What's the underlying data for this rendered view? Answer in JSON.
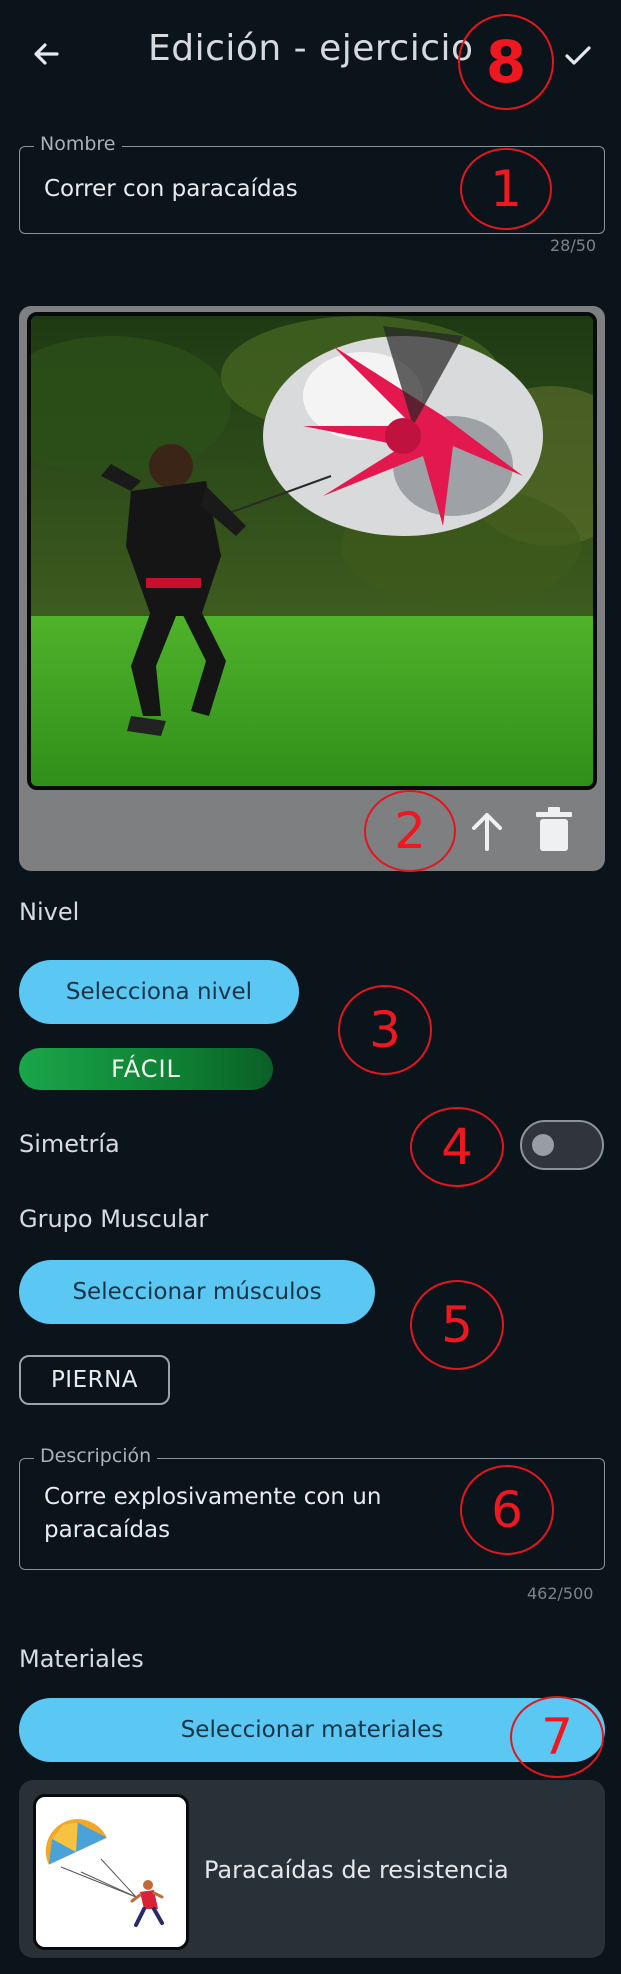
{
  "header": {
    "title": "Edición - ejercicio",
    "back_icon": "arrow-left-icon",
    "confirm_icon": "check-icon"
  },
  "name_field": {
    "legend": "Nombre",
    "value": "Correr con paracaídas",
    "counter": "28/50"
  },
  "image_section": {
    "upload_icon": "arrow-up-icon",
    "delete_icon": "trash-icon"
  },
  "level": {
    "label": "Nivel",
    "select_button": "Selecciona nivel",
    "selected": "FÁCIL"
  },
  "symmetry": {
    "label": "Simetría",
    "enabled": false
  },
  "muscle_group": {
    "label": "Grupo Muscular",
    "select_button": "Seleccionar músculos",
    "selected_chip": "PIERNA"
  },
  "description_field": {
    "legend": "Descripción",
    "value_line1": "Corre explosivamente con un",
    "value_line2": "paracaídas",
    "counter": "462/500"
  },
  "materials": {
    "label": "Materiales",
    "select_button": "Seleccionar materiales",
    "items": [
      {
        "name": "Paracaídas de resistencia"
      }
    ]
  },
  "annotations": [
    "1",
    "2",
    "3",
    "4",
    "5",
    "6",
    "7",
    "8"
  ],
  "colors": {
    "background": "#0c141b",
    "accent": "#5bc7f3",
    "level_badge": "#1aa64a",
    "annotation": "#e0171f"
  }
}
